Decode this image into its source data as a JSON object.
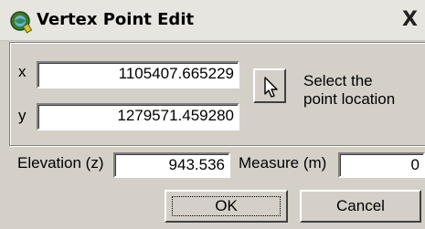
{
  "window": {
    "title": "Vertex Point Edit",
    "close_glyph": "X",
    "icon": "globe-gear-icon"
  },
  "coords": {
    "x_label": "x",
    "x_value": "1105407.665229",
    "y_label": "y",
    "y_value": "1279571.459280"
  },
  "pick": {
    "icon": "arrow-cursor-icon",
    "hint_line1": "Select the",
    "hint_line2": "point location"
  },
  "elevation": {
    "label": "Elevation (z)",
    "value": "943.536"
  },
  "measure": {
    "label": "Measure (m)",
    "value": "0"
  },
  "buttons": {
    "ok": "OK",
    "cancel": "Cancel"
  }
}
